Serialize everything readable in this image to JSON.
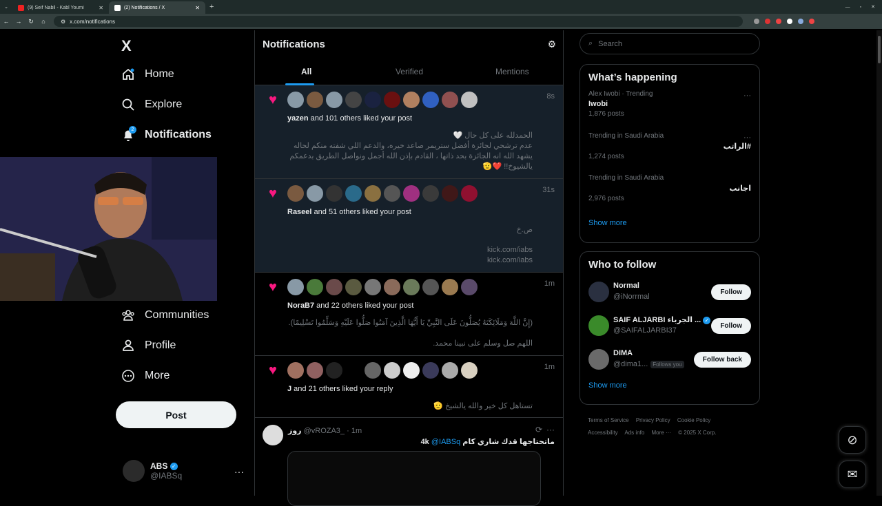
{
  "browser": {
    "tabs": [
      {
        "label": "(9) Seif Nabil - Kabl Youmi"
      },
      {
        "label": "(2) Notifications / X"
      }
    ],
    "url": "x.com/notifications"
  },
  "sidebar": {
    "logo": "X",
    "nav": [
      {
        "label": "Home",
        "icon": "home-icon"
      },
      {
        "label": "Explore",
        "icon": "search-icon"
      },
      {
        "label": "Notifications",
        "icon": "bell-icon",
        "badge": "2"
      },
      {
        "label": "Communities",
        "icon": "communities-icon"
      },
      {
        "label": "Profile",
        "icon": "profile-icon"
      },
      {
        "label": "More",
        "icon": "more-circle-icon"
      }
    ],
    "post_label": "Post",
    "account": {
      "name": "ABS",
      "handle": "@IABSq",
      "more": "···"
    }
  },
  "main": {
    "title": "Notifications",
    "tabs": [
      "All",
      "Verified",
      "Mentions"
    ],
    "notifications": [
      {
        "user": "yazen",
        "rest": " and 101 others liked your post",
        "time": "8s",
        "lines": [
          "الحمدلله على كل حال 🤍",
          "عدم ترشحي لجائزة أفضل ستريمر صاعد خيره، والدعم اللي شفته منكم لحاله",
          "يشهد الله انه الجائزة بحد ذاتها ، القادم بإذن الله أجمل ونواصل الطريق بدعمكم",
          "يالشيوخ!! ❤️🫡"
        ]
      },
      {
        "user": "Raseel",
        "rest": " and 51 others liked your post",
        "time": "31s",
        "lines": [
          "ص.خ",
          "kick.com/iabs",
          "kick.com/iabs"
        ]
      },
      {
        "user": "NoraB7",
        "rest": " and 22 others liked your post",
        "time": "1m",
        "lines": [
          "(إِنَّ اللَّهَ وَمَلَائِكَتَهُ يُصَلُّونَ عَلَى النَّبِيِّ يَا أَيُّهَا الَّذِينَ آمَنُوا صَلُّوا عَلَيْهِ وَسَلِّمُوا تَسْلِيمًا).",
          "اللهم صل وسلم على نبينا محمد."
        ]
      },
      {
        "user": "J",
        "rest": " and 21 others liked your reply",
        "time": "1m",
        "lines": [
          "تستاهل كل خير والله يالشيخ 🫡"
        ]
      }
    ],
    "tweet": {
      "name": "روز",
      "handle": "@vROZA3_",
      "time": "· 1m",
      "text": "ماتحتاجها قدك شاري كام 4k",
      "mention": "@IABSq",
      "more": "···"
    }
  },
  "right": {
    "search_placeholder": "Search",
    "happening": {
      "title": "What’s happening",
      "trends": [
        {
          "meta": "Alex Iwobi · Trending",
          "topic": "Iwobi",
          "posts": "1,876 posts"
        },
        {
          "meta": "Trending in Saudi Arabia",
          "topic": "#الراتب",
          "posts": "1,274 posts"
        },
        {
          "meta": "Trending in Saudi Arabia",
          "topic": "اجانب",
          "posts": "2,976 posts"
        }
      ],
      "show_more": "Show more"
    },
    "who_to_follow": {
      "title": "Who to follow",
      "users": [
        {
          "name": "Normal",
          "handle": "@iNorrmal",
          "button": "Follow"
        },
        {
          "name": "SAIF ALJARBI الجرباء ...",
          "handle": "@SAIFALJARBI37",
          "button": "Follow"
        },
        {
          "name": "DIMA",
          "handle": "@dima1...",
          "follows_you": "Follows you",
          "button": "Follow back"
        }
      ],
      "show_more": "Show more"
    },
    "footer": [
      "Terms of Service",
      "Privacy Policy",
      "Cookie Policy",
      "Accessibility",
      "Ads info",
      "More ···",
      "© 2025 X Corp."
    ]
  },
  "colors": {
    "accent": "#1d9bf0",
    "heart": "#f91880",
    "background": "#000000"
  }
}
